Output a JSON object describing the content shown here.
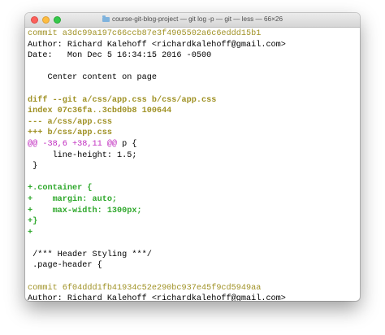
{
  "window": {
    "title": "course-git-blog-project — git log -p — git — less — 66×26"
  },
  "lines": {
    "l0": "commit a3dc99a197c66ccb87e3f4905502a6c6eddd15b1",
    "l1": "Author: Richard Kalehoff <richardkalehoff@gmail.com>",
    "l2": "Date:   Mon Dec 5 16:34:15 2016 -0500",
    "l3": "",
    "l4": "    Center content on page",
    "l5": "",
    "l6": "diff --git a/css/app.css b/css/app.css",
    "l7": "index 07c36fa..3cbd0b8 100644",
    "l8": "--- a/css/app.css",
    "l9": "+++ b/css/app.css",
    "l10_hunk": "@@ -38,6 +38,11 @@",
    "l10_ctx": " p {",
    "l11": "     line-height: 1.5;",
    "l12": " }",
    "l13": "",
    "l14": "+.container {",
    "l15": "+    margin: auto;",
    "l16": "+    max-width: 1300px;",
    "l17": "+}",
    "l18": "+",
    "l19": "",
    "l20": " /*** Header Styling ***/",
    "l21": " .page-header {",
    "l22": "",
    "l23": "commit 6f04ddd1fb41934c52e290bc937e45f9cd5949aa",
    "l24": "Author: Richard Kalehoff <richardkalehoff@gmail.com>",
    "l25": ":"
  },
  "colors": {
    "commit": "#a09226",
    "hunk": "#c02bbf",
    "added": "#2fa82c"
  }
}
